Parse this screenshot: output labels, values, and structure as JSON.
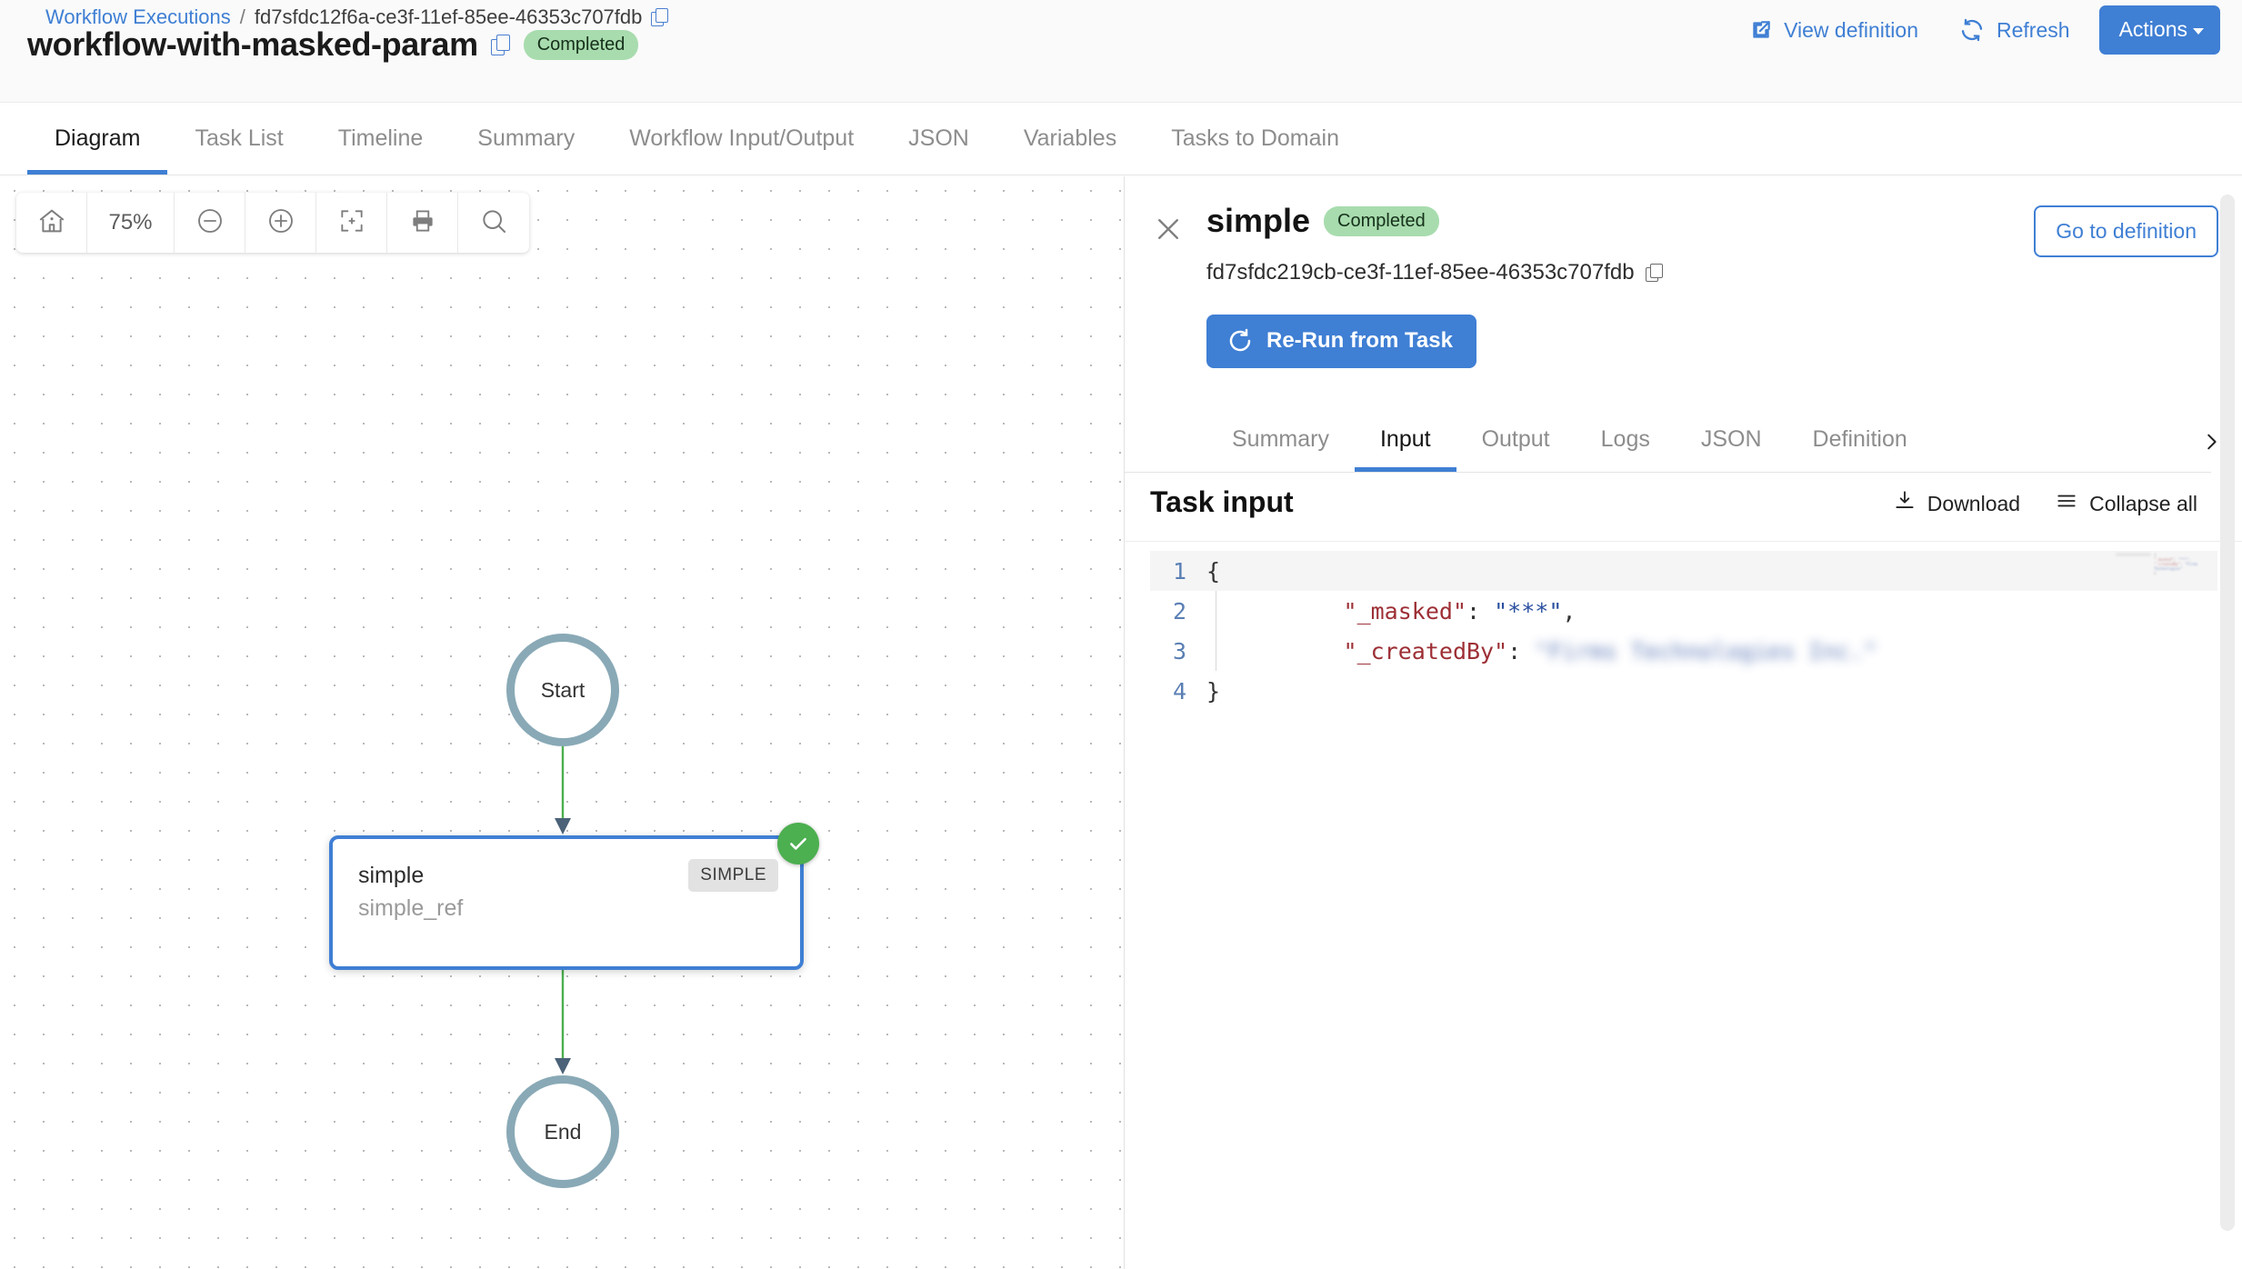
{
  "header": {
    "breadcrumb": {
      "root_label": "Workflow Executions",
      "separator": "/",
      "current_label": "fd7sfdc12f6a-ce3f-11ef-85ee-46353c707fdb",
      "copy_icon": "copy-icon"
    },
    "title": "workflow-with-masked-param",
    "title_copy_icon": "copy-icon",
    "status_badge": "Completed",
    "actions": {
      "view_definition": "View definition",
      "view_definition_icon": "external-link-icon",
      "refresh": "Refresh",
      "refresh_icon": "refresh-icon",
      "actions_label": "Actions",
      "actions_caret_icon": "chevron-down-icon"
    }
  },
  "main_tabs": [
    {
      "label": "Diagram",
      "active": true
    },
    {
      "label": "Task List",
      "active": false
    },
    {
      "label": "Timeline",
      "active": false
    },
    {
      "label": "Summary",
      "active": false
    },
    {
      "label": "Workflow Input/Output",
      "active": false
    },
    {
      "label": "JSON",
      "active": false
    },
    {
      "label": "Variables",
      "active": false
    },
    {
      "label": "Tasks to Domain",
      "active": false
    }
  ],
  "diagram": {
    "toolbar": {
      "home_icon": "home-icon",
      "zoom_level": "75%",
      "zoom_out_icon": "zoom-out-icon",
      "zoom_in_icon": "zoom-in-icon",
      "fit_screen_icon": "fit-to-screen-icon",
      "print_icon": "print-icon",
      "search_icon": "search-icon"
    },
    "nodes": {
      "start_label": "Start",
      "end_label": "End",
      "task_name": "simple",
      "task_ref": "simple_ref",
      "task_type": "SIMPLE",
      "task_status_icon": "check-circle-icon"
    },
    "colors": {
      "terminal_ring": "#89a9b6",
      "selected_node_border": "#3f7fd4",
      "edge": "#4caf50",
      "status_success": "#4caf50"
    }
  },
  "right_panel": {
    "close_icon": "close-icon",
    "title": "simple",
    "status_badge": "Completed",
    "task_id": "fd7sfdc219cb-ce3f-11ef-85ee-46353c707fdb",
    "task_id_copy_icon": "copy-icon",
    "goto_definition_label": "Go to definition",
    "rerun_label": "Re-Run from Task",
    "rerun_icon": "rerun-icon",
    "sub_tabs": [
      {
        "label": "Summary",
        "active": false
      },
      {
        "label": "Input",
        "active": true
      },
      {
        "label": "Output",
        "active": false
      },
      {
        "label": "Logs",
        "active": false
      },
      {
        "label": "JSON",
        "active": false
      },
      {
        "label": "Definition",
        "active": false
      }
    ],
    "sub_tabs_more_icon": "chevron-right-icon",
    "content": {
      "title": "Task input",
      "download_label": "Download",
      "download_icon": "download-icon",
      "collapse_label": "Collapse all",
      "collapse_icon": "collapse-all-icon",
      "code_lines": [
        {
          "num": "1",
          "indent": "",
          "key": "",
          "value": "",
          "brace": "{"
        },
        {
          "num": "2",
          "indent": "  ",
          "key": "\"_masked\"",
          "colon": ": ",
          "value": "\"***\"",
          "comma": ","
        },
        {
          "num": "3",
          "indent": "  ",
          "key": "\"_createdBy\"",
          "colon": ": ",
          "value_masked": "\"Firms Technologies Inc.\"",
          "redacted": true
        },
        {
          "num": "4",
          "indent": "",
          "key": "",
          "value": "",
          "brace": "}"
        }
      ]
    }
  },
  "colors": {
    "accent_blue": "#3f7fd4",
    "status_green_bg": "#a8dcae",
    "success_green": "#4caf50",
    "muted_text": "#8d8d8d"
  }
}
